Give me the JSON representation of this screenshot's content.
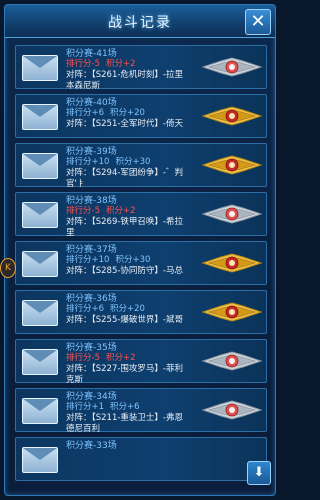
{
  "title": "战斗记录",
  "close_label": "✕",
  "records": [
    {
      "name": "积分赛-41场",
      "rank": "排行分-5",
      "points": "积分+2",
      "vs": "对阵：【S261-危机时刻】-拉里",
      "vs2": "本森尼斯",
      "neg": true,
      "medal": "silver"
    },
    {
      "name": "积分赛-40场",
      "rank": "排行分+6",
      "points": "积分+20",
      "vs": "对阵：【S251-全军时代】-倚天",
      "vs2": "",
      "neg": false,
      "medal": "gold"
    },
    {
      "name": "积分赛-39场",
      "rank": "排行分+10",
      "points": "积分+30",
      "vs": "对阵：【S294-军团纷争】-゛判",
      "vs2": "官'ￄ",
      "neg": false,
      "medal": "gold"
    },
    {
      "name": "积分赛-38场",
      "rank": "排行分-5",
      "points": "积分+2",
      "vs": "对阵：【S269-铁甲召唤】-希拉",
      "vs2": "里",
      "neg": true,
      "medal": "silver"
    },
    {
      "name": "积分赛-37场",
      "rank": "排行分+10",
      "points": "积分+30",
      "vs": "对阵：【S285-协同防守】-马总",
      "vs2": "",
      "neg": false,
      "medal": "gold"
    },
    {
      "name": "积分赛-36场",
      "rank": "排行分+6",
      "points": "积分+20",
      "vs": "对阵：【S255-爆破世界】-斌哥",
      "vs2": "",
      "neg": false,
      "medal": "gold"
    },
    {
      "name": "积分赛-35场",
      "rank": "排行分-5",
      "points": "积分+2",
      "vs": "对阵：【S227-围攻罗马】-菲利",
      "vs2": "克斯",
      "neg": true,
      "medal": "silver"
    },
    {
      "name": "积分赛-34场",
      "rank": "排行分+1",
      "points": "积分+6",
      "vs": "对阵：【S211-重装卫士】-弗恩",
      "vs2": "德尼百利",
      "neg": false,
      "medal": "silver"
    },
    {
      "name": "积分赛-33场",
      "rank": "",
      "points": "",
      "vs": "",
      "vs2": "",
      "neg": false,
      "medal": "none"
    }
  ],
  "side_tab": "K"
}
